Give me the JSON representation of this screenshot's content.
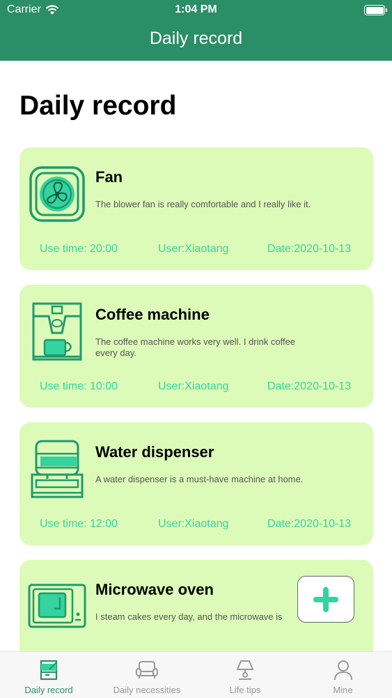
{
  "status_bar": {
    "carrier": "Carrier",
    "time": "1:04 PM"
  },
  "nav": {
    "title": "Daily record"
  },
  "page": {
    "title": "Daily record"
  },
  "records": [
    {
      "icon": "fan-icon",
      "title": "Fan",
      "description": "The blower fan is really comfortable and I really like it.",
      "use_time": "Use time: 20:00",
      "user": "User:Xiaotang",
      "date": "Date:2020-10-13"
    },
    {
      "icon": "coffee-machine-icon",
      "title": "Coffee machine",
      "description": "The coffee machine works very well. I drink coffee\nevery day.",
      "use_time": "Use time: 10:00",
      "user": "User:Xiaotang",
      "date": "Date:2020-10-13"
    },
    {
      "icon": "water-dispenser-icon",
      "title": "Water dispenser",
      "description": "A water dispenser is a must-have machine at home.",
      "use_time": "Use time: 12:00",
      "user": "User:Xiaotang",
      "date": "Date:2020-10-13"
    },
    {
      "icon": "microwave-oven-icon",
      "title": "Microwave oven",
      "description": "I steam cakes every day, and the microwave is",
      "use_time": "",
      "user": "",
      "date": ""
    }
  ],
  "fab": {
    "icon": "plus-icon"
  },
  "tabs": [
    {
      "label": "Daily record",
      "icon": "daily-record-icon",
      "active": true
    },
    {
      "label": "Daily necessities",
      "icon": "sofa-icon",
      "active": false
    },
    {
      "label": "Life tips",
      "icon": "lamp-icon",
      "active": false
    },
    {
      "label": "Mine",
      "icon": "person-icon",
      "active": false
    }
  ],
  "colors": {
    "primary": "#2a8e66",
    "card_bg": "#ddfbb8",
    "accent": "#34d3a0"
  }
}
